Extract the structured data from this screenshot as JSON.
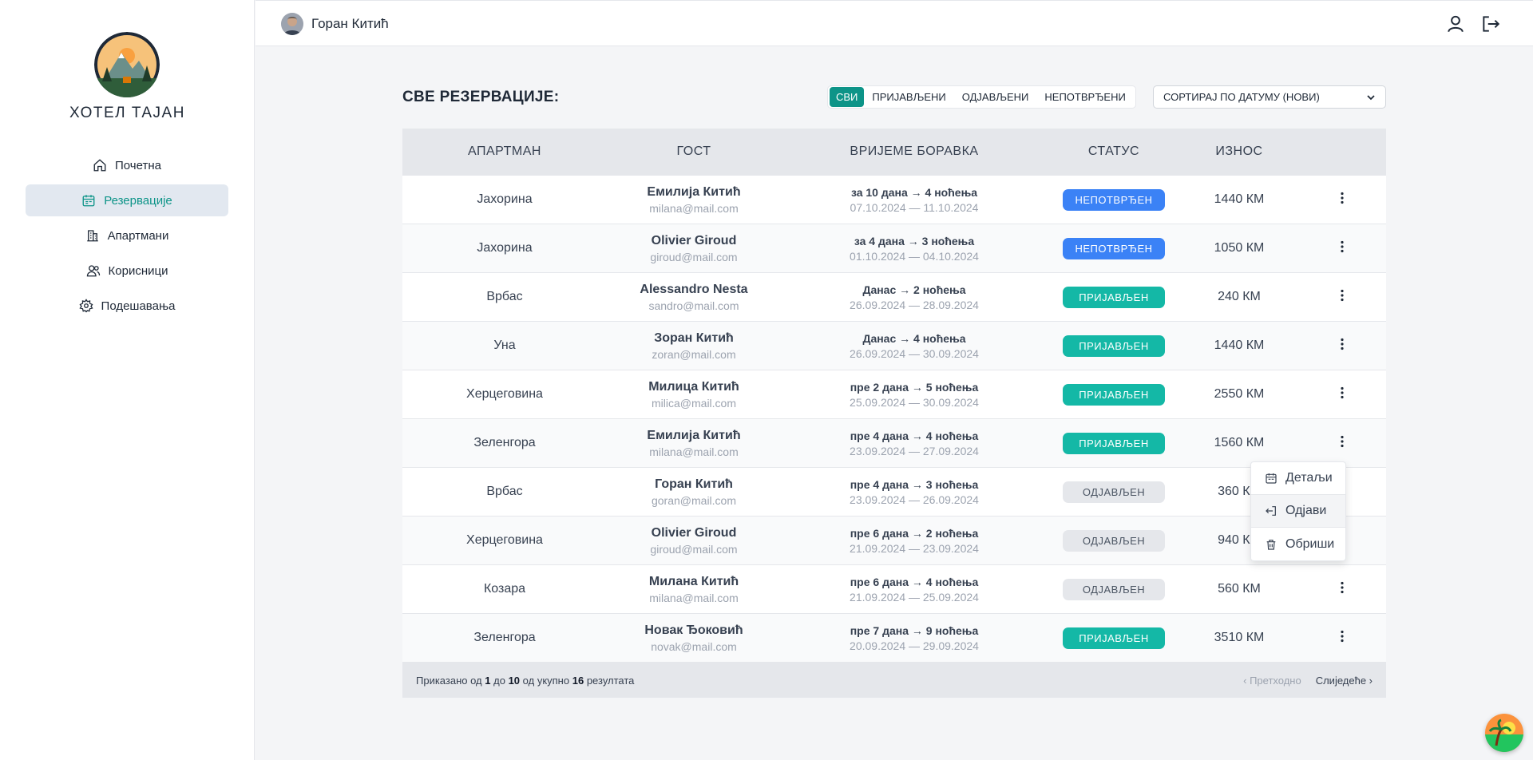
{
  "sidebar": {
    "hotel_name": "ХОТЕЛ ТАЈАН",
    "items": [
      {
        "label": "Почетна",
        "icon": "home-icon"
      },
      {
        "label": "Резервације",
        "icon": "calendar-icon",
        "active": true
      },
      {
        "label": "Апартмани",
        "icon": "building-icon"
      },
      {
        "label": "Корисници",
        "icon": "users-icon"
      },
      {
        "label": "Подешавања",
        "icon": "gear-icon"
      }
    ]
  },
  "header": {
    "user_name": "Горан Китић",
    "icons": [
      "user-icon",
      "logout-icon"
    ]
  },
  "main": {
    "title": "СВЕ РЕЗЕРВАЦИЈЕ:",
    "filters": [
      "СВИ",
      "ПРИЈАВЉЕНИ",
      "ОДЈАВЉЕНИ",
      "НЕПОТВРЂЕНИ"
    ],
    "active_filter": "СВИ",
    "sort_value": "СОРТИРАЈ ПО ДАТУМУ (НОВИ)",
    "columns": [
      "АПАРТМАН",
      "ГОСТ",
      "ВРИЈЕМЕ БОРАВКА",
      "СТАТУС",
      "ИЗНОС"
    ],
    "rows": [
      {
        "apartment": "Јахорина",
        "guest": "Емилија Китић",
        "email": "milana@mail.com",
        "stay": "за 10 дана → 4 ноћења",
        "dates": "07.10.2024 — 11.10.2024",
        "status": "НЕПОТВРЂЕН",
        "status_type": "blue",
        "amount": "1440 КМ"
      },
      {
        "apartment": "Јахорина",
        "guest": "Olivier Giroud",
        "email": "giroud@mail.com",
        "stay": "за 4 дана → 3 ноћења",
        "dates": "01.10.2024 — 04.10.2024",
        "status": "НЕПОТВРЂЕН",
        "status_type": "blue",
        "amount": "1050 КМ"
      },
      {
        "apartment": "Врбас",
        "guest": "Alessandro Nesta",
        "email": "sandro@mail.com",
        "stay": "Данас → 2 ноћења",
        "dates": "26.09.2024 — 28.09.2024",
        "status": "ПРИЈАВЉЕН",
        "status_type": "teal",
        "amount": "240 КМ"
      },
      {
        "apartment": "Уна",
        "guest": "Зоран Китић",
        "email": "zoran@mail.com",
        "stay": "Данас → 4 ноћења",
        "dates": "26.09.2024 — 30.09.2024",
        "status": "ПРИЈАВЉЕН",
        "status_type": "teal",
        "amount": "1440 КМ"
      },
      {
        "apartment": "Херцеговина",
        "guest": "Милица Китић",
        "email": "milica@mail.com",
        "stay": "пре 2 дана → 5 ноћења",
        "dates": "25.09.2024 — 30.09.2024",
        "status": "ПРИЈАВЉЕН",
        "status_type": "teal",
        "amount": "2550 КМ"
      },
      {
        "apartment": "Зеленгора",
        "guest": "Емилија Китић",
        "email": "milana@mail.com",
        "stay": "пре 4 дана → 4 ноћења",
        "dates": "23.09.2024 — 27.09.2024",
        "status": "ПРИЈАВЉЕН",
        "status_type": "teal",
        "amount": "1560 КМ"
      },
      {
        "apartment": "Врбас",
        "guest": "Горан Китић",
        "email": "goran@mail.com",
        "stay": "пре 4 дана → 3 ноћења",
        "dates": "23.09.2024 — 26.09.2024",
        "status": "ОДЈАВЉЕН",
        "status_type": "gray",
        "amount": "360 КМ"
      },
      {
        "apartment": "Херцеговина",
        "guest": "Olivier Giroud",
        "email": "giroud@mail.com",
        "stay": "пре 6 дана → 2 ноћења",
        "dates": "21.09.2024 — 23.09.2024",
        "status": "ОДЈАВЉЕН",
        "status_type": "gray",
        "amount": "940 КМ"
      },
      {
        "apartment": "Козара",
        "guest": "Милана Китић",
        "email": "milana@mail.com",
        "stay": "пре 6 дана → 4 ноћења",
        "dates": "21.09.2024 — 25.09.2024",
        "status": "ОДЈАВЉЕН",
        "status_type": "gray",
        "amount": "560 КМ"
      },
      {
        "apartment": "Зеленгора",
        "guest": "Новак Ђоковић",
        "email": "novak@mail.com",
        "stay": "пре 7 дана → 9 ноћења",
        "dates": "20.09.2024 — 29.09.2024",
        "status": "ПРИЈАВЉЕН",
        "status_type": "teal",
        "amount": "3510 КМ"
      }
    ],
    "footer": {
      "text_prefix": "Приказано од",
      "from": "1",
      "text_to": "до",
      "to": "10",
      "text_total": "од укупно",
      "total": "16",
      "text_suffix": "резултата",
      "prev": "Претходно",
      "next": "Слиједеће"
    }
  },
  "context_menu": {
    "items": [
      {
        "label": "Детаљи",
        "icon": "calendar-icon"
      },
      {
        "label": "Одјави",
        "icon": "logout-icon"
      },
      {
        "label": "Обриши",
        "icon": "trash-icon"
      }
    ]
  },
  "colors": {
    "accent": "#0d9488",
    "status_blue": "#3b82f6",
    "status_teal": "#14b8a6",
    "status_gray": "#e5e7eb"
  }
}
